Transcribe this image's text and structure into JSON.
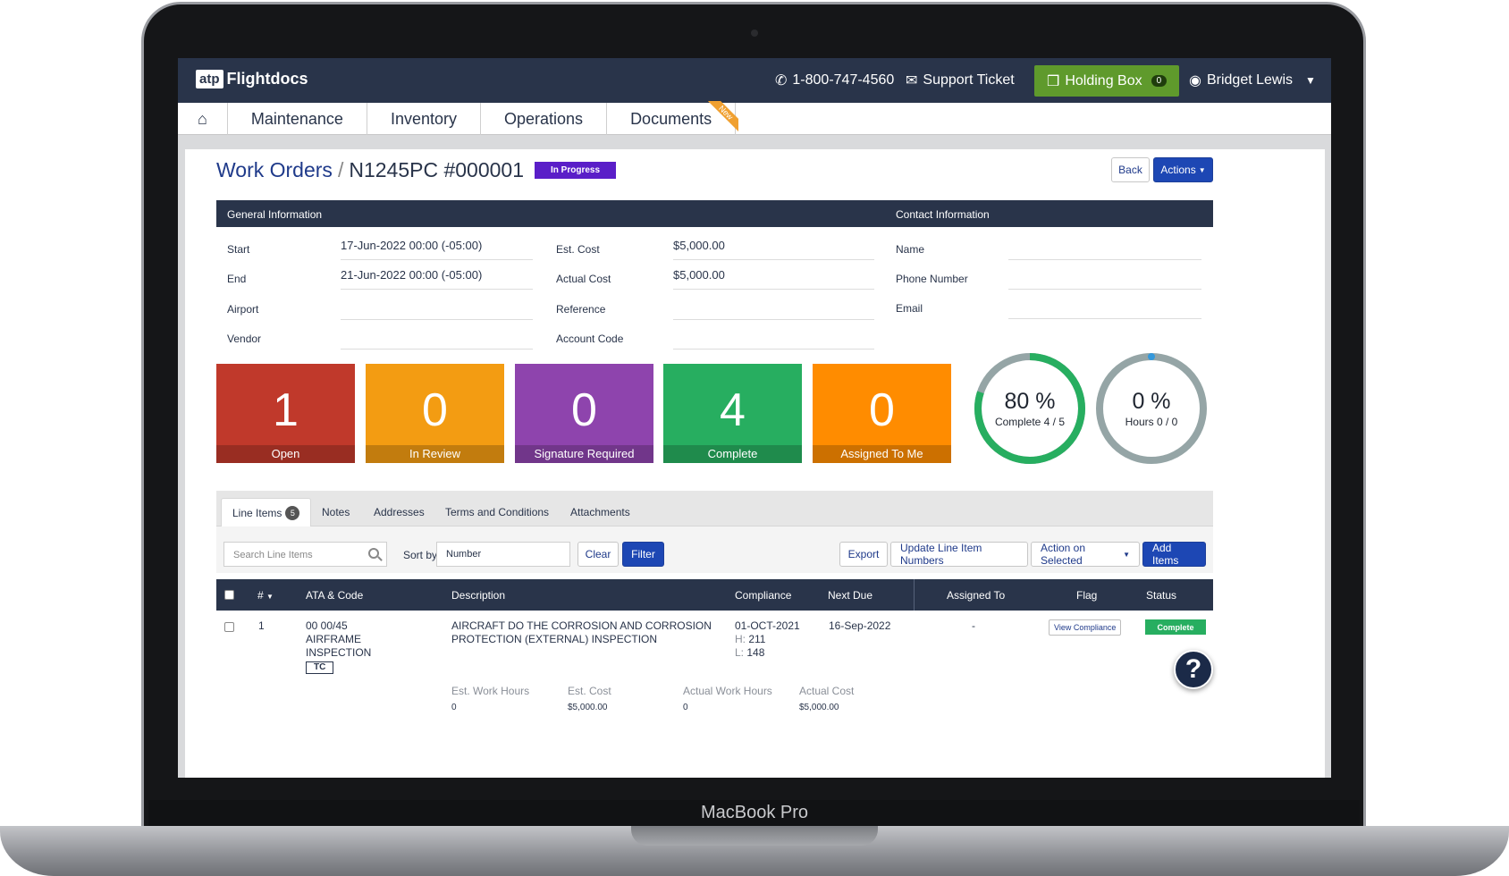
{
  "device": {
    "label": "MacBook Pro"
  },
  "header": {
    "logo_prefix": "atp",
    "logo_text": "Flightdocs",
    "phone": "1-800-747-4560",
    "support": "Support Ticket",
    "holding_box": "Holding Box",
    "holding_count": "0",
    "user": "Bridget Lewis"
  },
  "nav": {
    "items": [
      "Maintenance",
      "Inventory",
      "Operations",
      "Documents"
    ],
    "new_ribbon": "New"
  },
  "page": {
    "breadcrumb_link": "Work Orders",
    "separator": "/",
    "title": "N1245PC #000001",
    "status": "In Progress",
    "back": "Back",
    "actions": "Actions"
  },
  "general": {
    "header": "General Information",
    "contact_header": "Contact Information",
    "start_label": "Start",
    "start_value": "17-Jun-2022 00:00 (-05:00)",
    "end_label": "End",
    "end_value": "21-Jun-2022 00:00 (-05:00)",
    "airport_label": "Airport",
    "vendor_label": "Vendor",
    "est_cost_label": "Est. Cost",
    "est_cost_value": "$5,000.00",
    "actual_cost_label": "Actual Cost",
    "actual_cost_value": "$5,000.00",
    "reference_label": "Reference",
    "account_code_label": "Account Code",
    "name_label": "Name",
    "phone_label": "Phone Number",
    "email_label": "Email"
  },
  "tiles": [
    {
      "value": "1",
      "label": "Open",
      "color": "#c0392b"
    },
    {
      "value": "0",
      "label": "In Review",
      "color": "#f39c12"
    },
    {
      "value": "0",
      "label": "Signature Required",
      "color": "#8e44ad"
    },
    {
      "value": "4",
      "label": "Complete",
      "color": "#27ae60"
    },
    {
      "value": "0",
      "label": "Assigned To Me",
      "color": "#ff8c00"
    }
  ],
  "gauges": [
    {
      "pct": "80 %",
      "sub": "Complete 4 / 5",
      "fraction": 0.8,
      "color": "#27ae60"
    },
    {
      "pct": "0 %",
      "sub": "Hours 0 / 0",
      "fraction": 0.0,
      "color": "#3498db"
    }
  ],
  "tabs": {
    "line_items": "Line Items",
    "line_items_count": "5",
    "notes": "Notes",
    "addresses": "Addresses",
    "terms": "Terms and Conditions",
    "attachments": "Attachments"
  },
  "toolbar": {
    "search_placeholder": "Search Line Items",
    "sort_label": "Sort by",
    "sort_value": "Number",
    "clear": "Clear",
    "filter": "Filter",
    "export": "Export",
    "update_numbers": "Update Line Item Numbers",
    "action_selected": "Action on Selected",
    "add_items": "Add Items"
  },
  "table": {
    "columns": {
      "num": "#",
      "ata": "ATA & Code",
      "description": "Description",
      "compliance": "Compliance",
      "next_due": "Next Due",
      "assigned": "Assigned To",
      "flag": "Flag",
      "status": "Status"
    },
    "row": {
      "num": "1",
      "ata_code": "00 00/45",
      "ata_name1": "AIRFRAME",
      "ata_name2": "INSPECTION",
      "tag": "TC",
      "desc1": "AIRCRAFT DO THE CORROSION AND CORROSION",
      "desc2": "PROTECTION (EXTERNAL) INSPECTION",
      "compliance_date": "01-OCT-2021",
      "h_label": "H:",
      "h_value": "211",
      "l_label": "L:",
      "l_value": "148",
      "next_due": "16-Sep-2022",
      "assigned": "-",
      "flag_button": "View Compliance",
      "status": "Complete",
      "est_hours_label": "Est. Work Hours",
      "est_hours": "0",
      "est_cost_label": "Est. Cost",
      "est_cost": "$5,000.00",
      "actual_hours_label": "Actual Work Hours",
      "actual_hours": "0",
      "actual_cost_label": "Actual Cost",
      "actual_cost": "$5,000.00"
    }
  },
  "help": "?"
}
